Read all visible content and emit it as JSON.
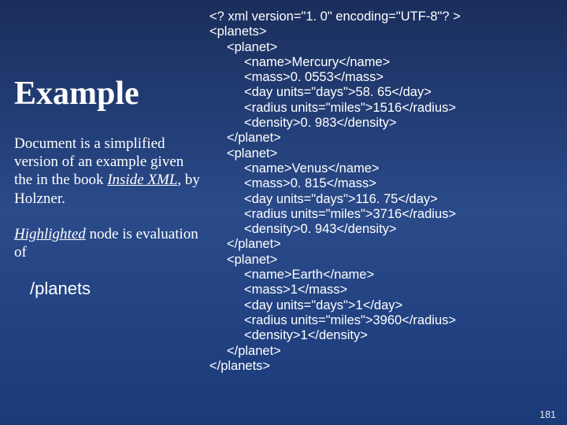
{
  "left": {
    "heading": "Example",
    "para1_a": "Document is a simplified version of an example given the in the book ",
    "para1_book": "Inside XML",
    "para1_b": ", by Holzner.",
    "para2_hi": "Highlighted",
    "para2_rest": " node is evaluation of",
    "expr": "/planets"
  },
  "xml": {
    "l00": "<? xml version=\"1. 0\" encoding=\"UTF-8\"? >",
    "l01": "<planets>",
    "l02": "<planet>",
    "l03": "<name>Mercury</name>",
    "l04": "<mass>0. 0553</mass>",
    "l05": "<day units=\"days\">58. 65</day>",
    "l06": "<radius units=\"miles\">1516</radius>",
    "l07": "<density>0. 983</density>",
    "l08": "</planet>",
    "l09": "<planet>",
    "l10": "<name>Venus</name>",
    "l11": "<mass>0. 815</mass>",
    "l12": "<day units=\"days\">116. 75</day>",
    "l13": "<radius units=\"miles\">3716</radius>",
    "l14": "<density>0. 943</density>",
    "l15": "</planet>",
    "l16": "<planet>",
    "l17": "<name>Earth</name>",
    "l18": "<mass>1</mass>",
    "l19": "<day units=\"days\">1</day>",
    "l20": "<radius units=\"miles\">3960</radius>",
    "l21": "<density>1</density>",
    "l22": "</planet>",
    "l23": "</planets>"
  },
  "page": "181"
}
